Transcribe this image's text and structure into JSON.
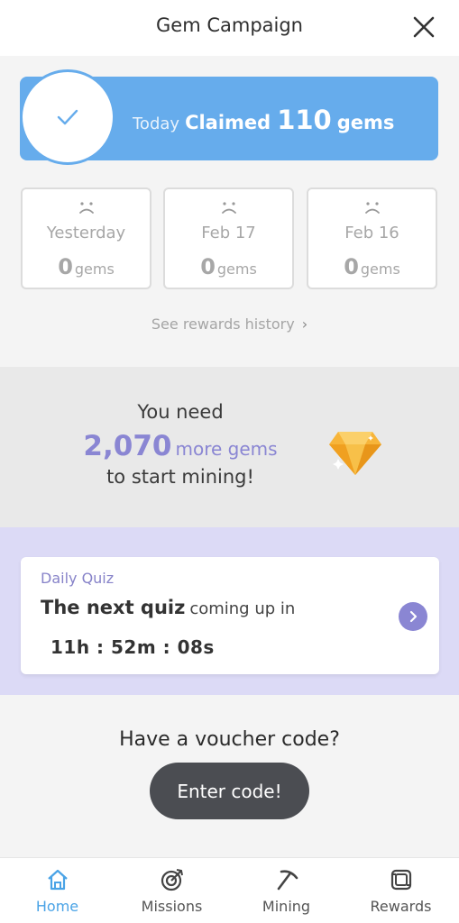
{
  "header": {
    "title": "Gem Campaign",
    "close_icon": "close-icon"
  },
  "today": {
    "label": "Today",
    "claimed_label": "Claimed",
    "gems": "110",
    "unit": "gems",
    "icon": "checkmark-icon",
    "color": "#66acec"
  },
  "days": [
    {
      "label": "Yesterday",
      "count": "0",
      "unit": "gems",
      "icon": "sad-face-icon"
    },
    {
      "label": "Feb 17",
      "count": "0",
      "unit": "gems",
      "icon": "sad-face-icon"
    },
    {
      "label": "Feb 16",
      "count": "0",
      "unit": "gems",
      "icon": "sad-face-icon"
    }
  ],
  "history_link": "See rewards history",
  "need": {
    "line1": "You need",
    "amount": "2,070",
    "more": "more gems",
    "line3": "to start mining!",
    "icon": "gem-icon",
    "accent": "#8a86d3"
  },
  "quiz": {
    "label": "Daily Quiz",
    "title_strong": "The next quiz",
    "title_rest": "coming up in",
    "timer": "11h  : 52m : 08s"
  },
  "voucher": {
    "title": "Have a voucher code?",
    "button": "Enter code!"
  },
  "nav": {
    "active": "Home",
    "items": [
      {
        "label": "Home",
        "icon": "home-icon"
      },
      {
        "label": "Missions",
        "icon": "target-icon"
      },
      {
        "label": "Mining",
        "icon": "pickaxe-icon"
      },
      {
        "label": "Rewards",
        "icon": "gift-box-icon"
      }
    ]
  }
}
